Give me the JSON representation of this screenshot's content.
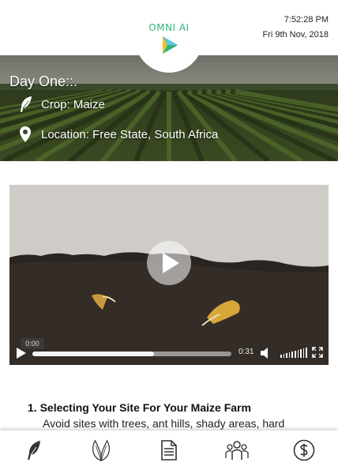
{
  "header": {
    "logo_text": "OMNI AI",
    "time": "7:52:28 PM",
    "date": "Fri 9th Nov, 2018"
  },
  "hero": {
    "title": "Day One::.",
    "crop": "Crop: Maize",
    "location": "Location: Free State, South Africa"
  },
  "video": {
    "current_time": "0:00",
    "duration": "0:31",
    "progress_fraction": 0.61,
    "volume_fraction": 1.0
  },
  "article": {
    "heading": "1. Selecting Your Site For Your Maize Farm",
    "body": "Avoid sites with trees, ant hills, shady areas, hard"
  },
  "bottom_nav": {
    "items": [
      {
        "icon": "feather-icon"
      },
      {
        "icon": "leaves-icon"
      },
      {
        "icon": "document-icon"
      },
      {
        "icon": "community-icon"
      },
      {
        "icon": "dollar-icon"
      }
    ]
  },
  "colors": {
    "logo_green": "#2fb67a",
    "logo_blue": "#2a7fd4"
  }
}
